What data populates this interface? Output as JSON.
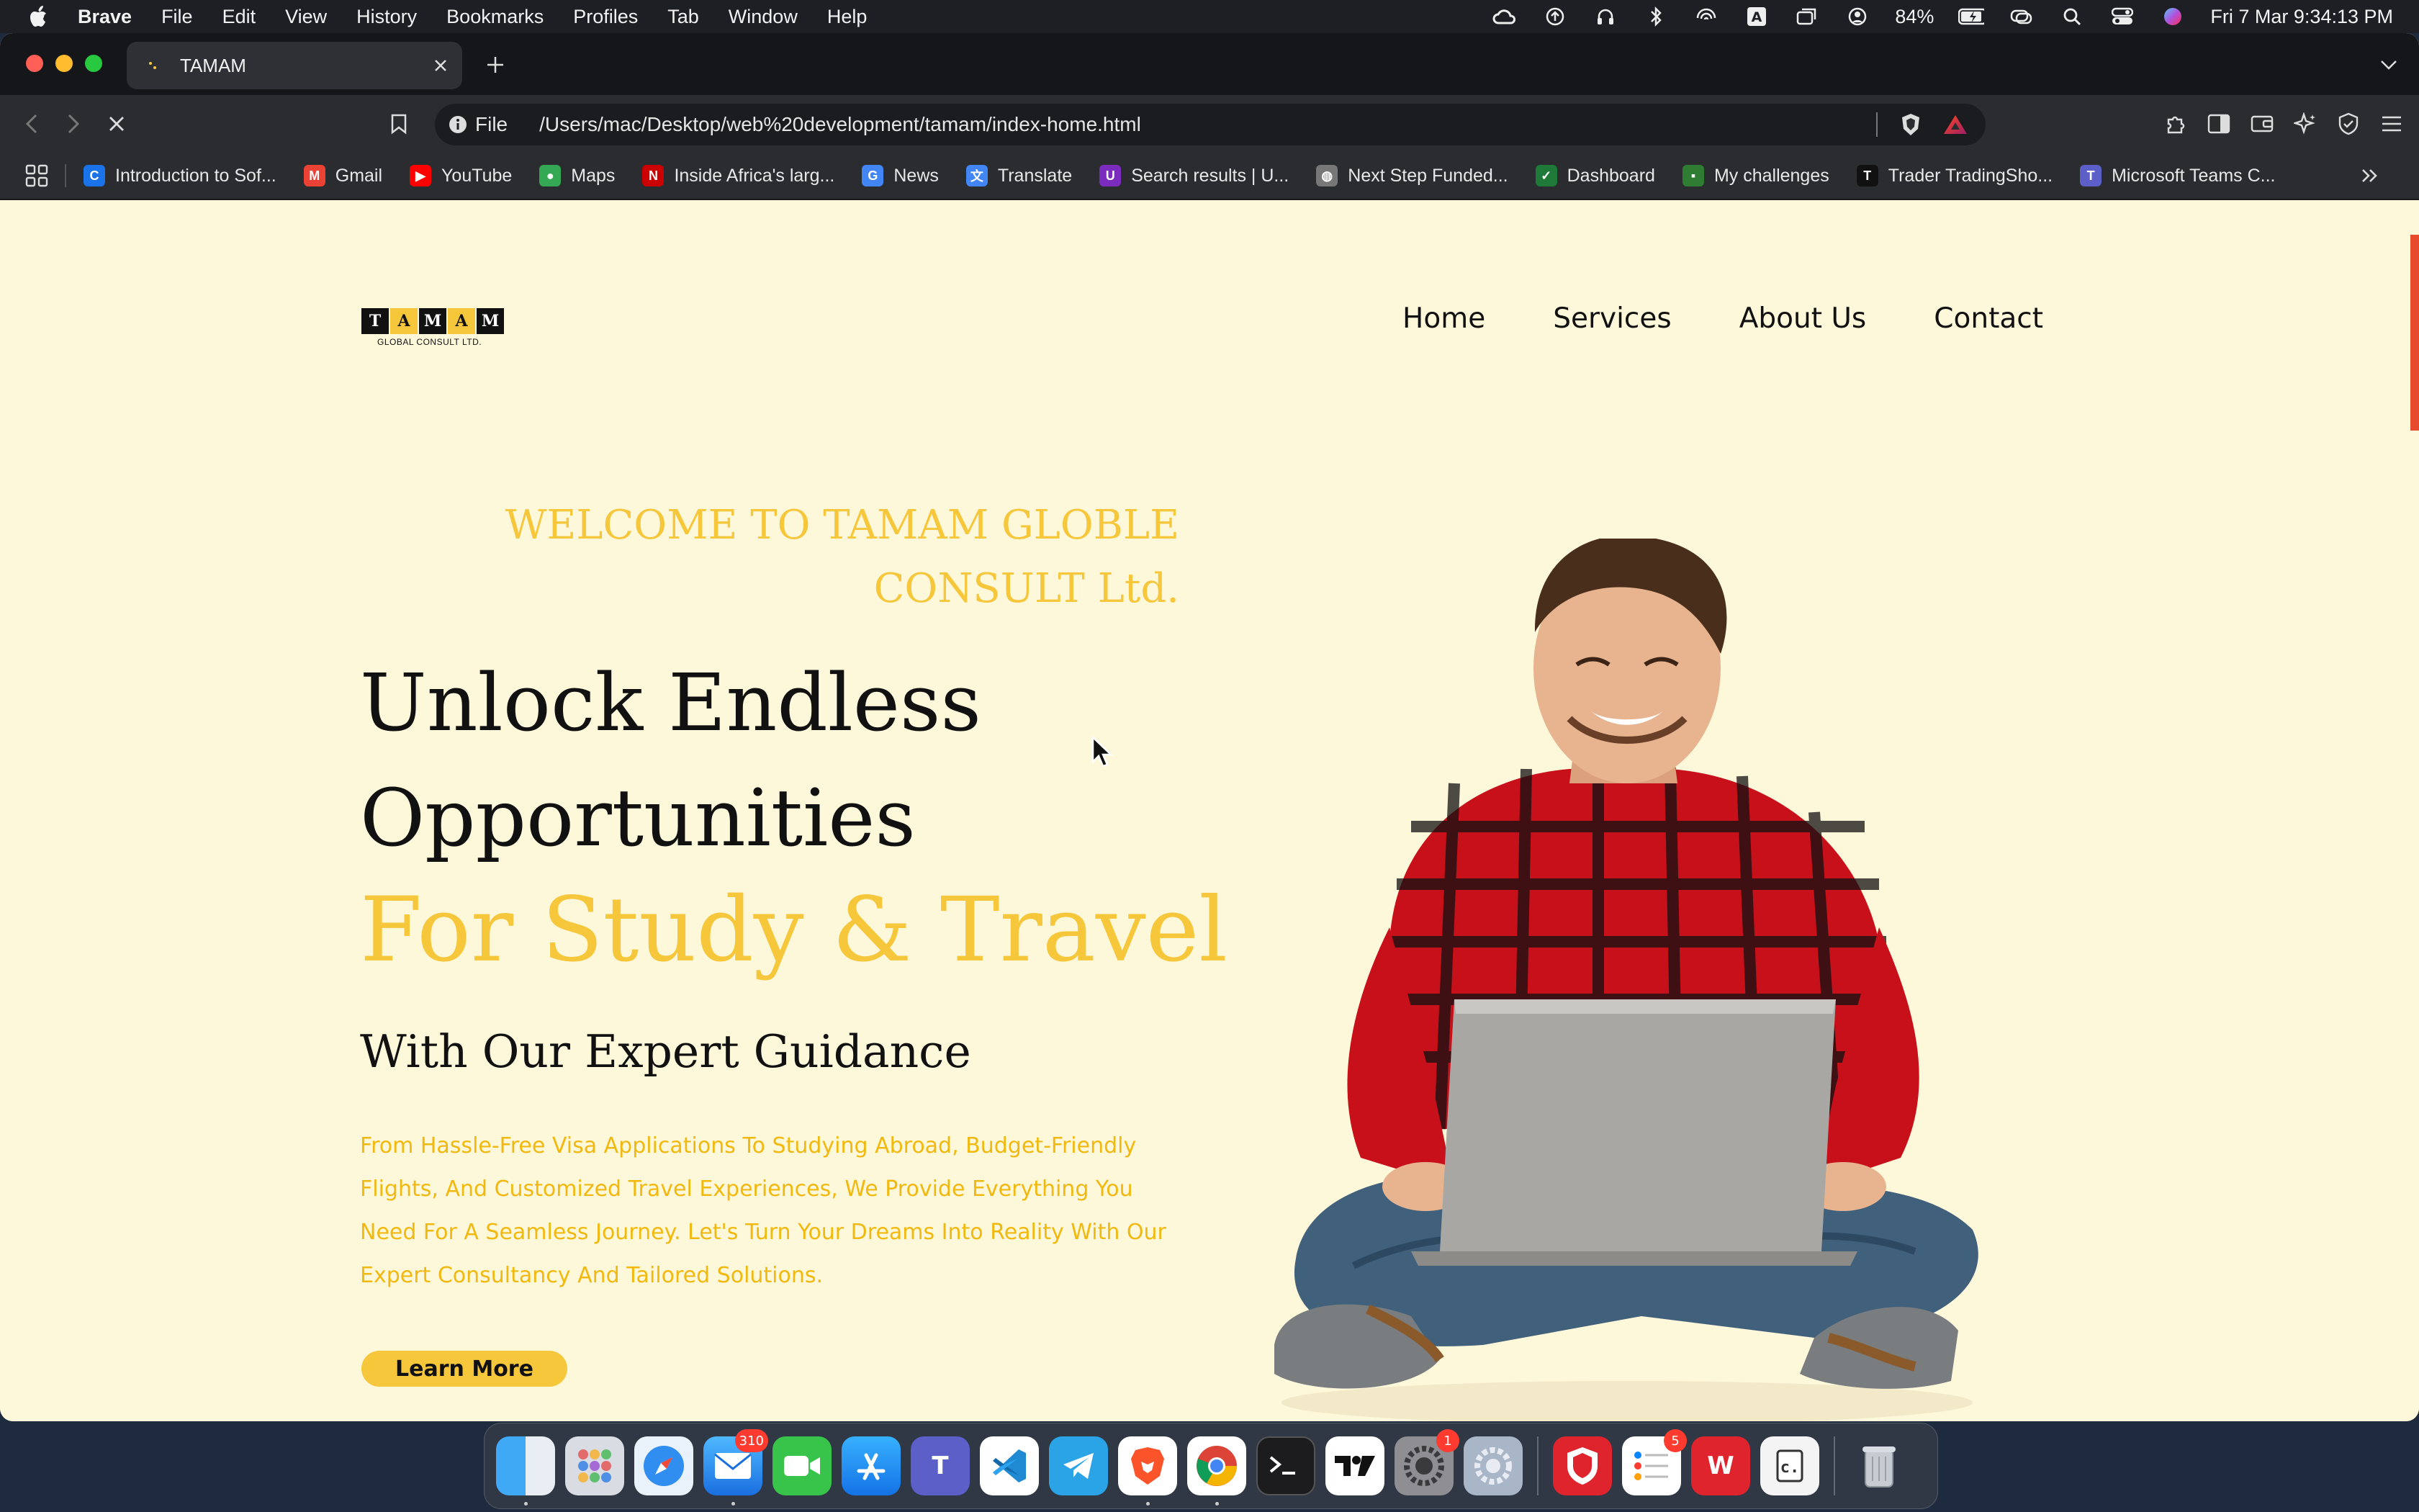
{
  "menubar": {
    "app": "Brave",
    "items": [
      "File",
      "Edit",
      "View",
      "History",
      "Bookmarks",
      "Profiles",
      "Tab",
      "Window",
      "Help"
    ],
    "battery": "84%",
    "datetime": "Fri 7 Mar  9:34:13 PM"
  },
  "browser": {
    "tab_title": "TAMAM",
    "url_scheme": "File",
    "url_path": "/Users/mac/Desktop/web%20development/tamam/index-home.html",
    "bookmarks": [
      {
        "label": "Introduction to Sof...",
        "color": "#1a73e8",
        "glyph": "C"
      },
      {
        "label": "Gmail",
        "color": "#ea4335",
        "glyph": "M"
      },
      {
        "label": "YouTube",
        "color": "#ff0000",
        "glyph": "▶"
      },
      {
        "label": "Maps",
        "color": "#34a853",
        "glyph": "●"
      },
      {
        "label": "Inside Africa's larg...",
        "color": "#cc0000",
        "glyph": "N"
      },
      {
        "label": "News",
        "color": "#4285f4",
        "glyph": "G"
      },
      {
        "label": "Translate",
        "color": "#4285f4",
        "glyph": "文"
      },
      {
        "label": "Search results | U...",
        "color": "#7b2cbf",
        "glyph": "U"
      },
      {
        "label": "Next Step Funded...",
        "color": "#777777",
        "glyph": "◍"
      },
      {
        "label": "Dashboard",
        "color": "#1f7a3a",
        "glyph": "✓"
      },
      {
        "label": "My challenges",
        "color": "#2e7d32",
        "glyph": "▪"
      },
      {
        "label": "Trader TradingSho...",
        "color": "#111111",
        "glyph": "T"
      },
      {
        "label": "Microsoft Teams C...",
        "color": "#5b5fc7",
        "glyph": "T"
      }
    ]
  },
  "site": {
    "logo_letters": [
      "T",
      "A",
      "M",
      "A",
      "M"
    ],
    "logo_sub": "GLOBAL CONSULT LTD.",
    "nav": [
      "Home",
      "Services",
      "About Us",
      "Contact"
    ],
    "welcome_line1": "WELCOME TO TAMAM GLOBLE",
    "welcome_line2": "CONSULT Ltd.",
    "headline_line1": "Unlock Endless",
    "headline_line2": "Opportunities",
    "headline_line3": "For Study & Travel",
    "subheadline": "With Our Expert Guidance",
    "description": "From Hassle-Free Visa Applications To Studying Abroad, Budget-Friendly Flights, And Customized Travel Experiences, We Provide Everything You Need For A Seamless Journey. Let's Turn Your Dreams Into Reality With Our Expert Consultancy And Tailored Solutions.",
    "cta": "Learn More",
    "accent": "#f6c63b",
    "background": "#fef8db"
  },
  "dock": {
    "mail_badge": "310",
    "settings_badge": "1",
    "reminders_badge": "5",
    "apps": [
      "finder-icon",
      "launchpad-icon",
      "safari-icon",
      "mail-icon",
      "facetime-icon",
      "app-store-icon",
      "teams-icon",
      "vscode-icon",
      "telegram-icon",
      "brave-icon",
      "chrome-icon",
      "terminal-icon",
      "tradingview-icon",
      "system-settings-icon",
      "preferences-icon",
      "vpn-icon",
      "reminders-icon",
      "wps-icon",
      "codeblocks-icon",
      "trash-icon"
    ]
  }
}
